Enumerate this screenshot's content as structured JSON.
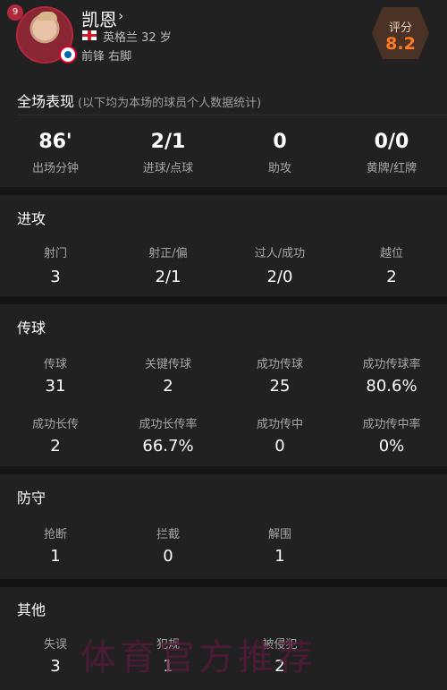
{
  "player": {
    "number": "9",
    "name": "凯恩",
    "chevron": "›",
    "nation_age": "英格兰 32 岁",
    "position": "前锋  右脚",
    "flag_icon": "england-flag-icon",
    "club_icon": "bayern-badge-icon"
  },
  "rating": {
    "label": "评分",
    "value": "8.2",
    "accent": "#ff7a1e"
  },
  "summary": {
    "title": "全场表现",
    "subtitle": "(以下均为本场的球员个人数据统计)",
    "items": [
      {
        "value": "86'",
        "label": "出场分钟"
      },
      {
        "value": "2/1",
        "label": "进球/点球"
      },
      {
        "value": "0",
        "label": "助攻"
      },
      {
        "value": "0/0",
        "label": "黄牌/红牌"
      }
    ]
  },
  "attack": {
    "title": "进攻",
    "items": [
      {
        "label": "射门",
        "value": "3"
      },
      {
        "label": "射正/偏",
        "value": "2/1"
      },
      {
        "label": "过人/成功",
        "value": "2/0"
      },
      {
        "label": "越位",
        "value": "2"
      }
    ]
  },
  "passing": {
    "title": "传球",
    "items": [
      {
        "label": "传球",
        "value": "31"
      },
      {
        "label": "关键传球",
        "value": "2"
      },
      {
        "label": "成功传球",
        "value": "25"
      },
      {
        "label": "成功传球率",
        "value": "80.6%"
      },
      {
        "label": "成功长传",
        "value": "2"
      },
      {
        "label": "成功长传率",
        "value": "66.7%"
      },
      {
        "label": "成功传中",
        "value": "0"
      },
      {
        "label": "成功传中率",
        "value": "0%"
      }
    ]
  },
  "defense": {
    "title": "防守",
    "items": [
      {
        "label": "抢断",
        "value": "1"
      },
      {
        "label": "拦截",
        "value": "0"
      },
      {
        "label": "解围",
        "value": "1"
      }
    ]
  },
  "other": {
    "title": "其他",
    "items": [
      {
        "label": "失误",
        "value": "3"
      },
      {
        "label": "犯规",
        "value": "1"
      },
      {
        "label": "被侵犯",
        "value": "2"
      }
    ]
  },
  "watermark": "体育官方推荐"
}
